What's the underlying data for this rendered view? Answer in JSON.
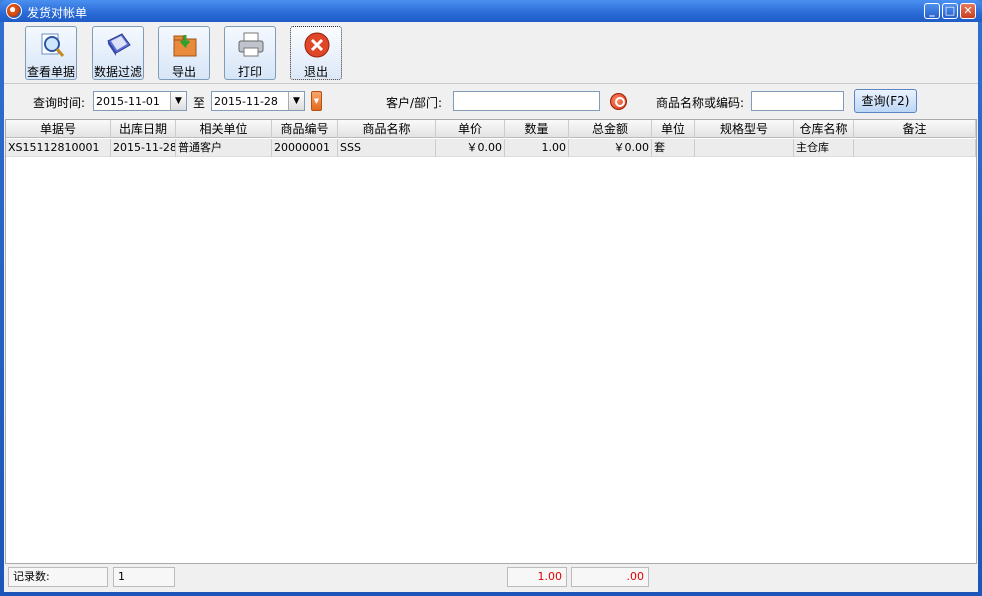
{
  "window": {
    "title": "发货对帐单"
  },
  "toolbar": {
    "view_label": "查看单据",
    "filter_label": "数据过滤",
    "export_label": "导出",
    "print_label": "打印",
    "exit_label": "退出"
  },
  "filter": {
    "time_label": "查询时间:",
    "start_date": "2015-11-01",
    "to_label": "至",
    "end_date": "2015-11-28",
    "customer_label": "客户/部门:",
    "customer_value": "",
    "product_label": "商品名称或编码:",
    "product_value": "",
    "query_label": "查询(F2)"
  },
  "table": {
    "columns": [
      "单据号",
      "出库日期",
      "相关单位",
      "商品编号",
      "商品名称",
      "单价",
      "数量",
      "总金额",
      "单位",
      "规格型号",
      "仓库名称",
      "备注"
    ],
    "rows": [
      [
        "XS15112810001",
        "2015-11-28",
        "普通客户",
        "20000001",
        "SSS",
        "￥0.00",
        "1.00",
        "￥0.00",
        "套",
        "",
        "主仓库",
        ""
      ]
    ]
  },
  "status": {
    "count_label": "记录数:",
    "count_value": "1",
    "qty_total": "1.00",
    "amount_total": ".00"
  },
  "colors": {
    "title_bar": "#2a6ad6",
    "total_text": "#dd0000"
  }
}
